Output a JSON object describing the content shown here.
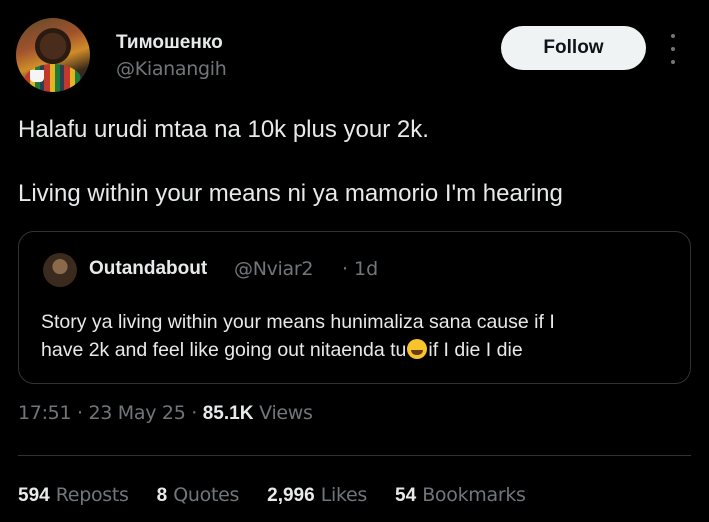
{
  "author": {
    "name": "Тимошенко",
    "handle": "@Kianangih"
  },
  "follow_label": "Follow",
  "tweet": {
    "line1": "Halafu urudi mtaa na 10k plus your 2k.",
    "line2": "Living within your means ni ya mamorio I'm hearing"
  },
  "quote": {
    "name": "Outandabout",
    "handle": "@Nviar2",
    "separator": "·",
    "time": "1d",
    "line1": "Story ya living within your means hunimaliza sana cause if I",
    "line2a": "have 2k and feel like going out nitaenda tu",
    "emoji": "rolling-on-floor-laughing-emoji",
    "line2b": "if I die I die"
  },
  "meta": {
    "time": "17:51",
    "sep1": " · ",
    "date": "23 May 25",
    "sep2": " · ",
    "views_count": "85.1K",
    "views_label": " Views"
  },
  "stats": [
    {
      "num": "594",
      "label": "Reposts"
    },
    {
      "num": "8",
      "label": "Quotes"
    },
    {
      "num": "2,996",
      "label": "Likes"
    },
    {
      "num": "54",
      "label": "Bookmarks"
    }
  ],
  "colors": {
    "background": "#000000",
    "text": "#e7e9ea",
    "muted": "#71767b",
    "border": "#2f3336",
    "follow_bg": "#eff3f4"
  }
}
